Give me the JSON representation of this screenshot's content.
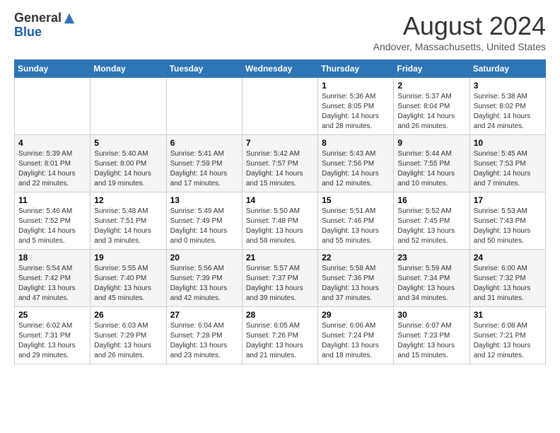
{
  "header": {
    "logo_line1": "General",
    "logo_line2": "Blue",
    "month_year": "August 2024",
    "location": "Andover, Massachusetts, United States"
  },
  "calendar": {
    "days_of_week": [
      "Sunday",
      "Monday",
      "Tuesday",
      "Wednesday",
      "Thursday",
      "Friday",
      "Saturday"
    ],
    "weeks": [
      [
        {
          "day": "",
          "info": ""
        },
        {
          "day": "",
          "info": ""
        },
        {
          "day": "",
          "info": ""
        },
        {
          "day": "",
          "info": ""
        },
        {
          "day": "1",
          "info": "Sunrise: 5:36 AM\nSunset: 8:05 PM\nDaylight: 14 hours\nand 28 minutes."
        },
        {
          "day": "2",
          "info": "Sunrise: 5:37 AM\nSunset: 8:04 PM\nDaylight: 14 hours\nand 26 minutes."
        },
        {
          "day": "3",
          "info": "Sunrise: 5:38 AM\nSunset: 8:02 PM\nDaylight: 14 hours\nand 24 minutes."
        }
      ],
      [
        {
          "day": "4",
          "info": "Sunrise: 5:39 AM\nSunset: 8:01 PM\nDaylight: 14 hours\nand 22 minutes."
        },
        {
          "day": "5",
          "info": "Sunrise: 5:40 AM\nSunset: 8:00 PM\nDaylight: 14 hours\nand 19 minutes."
        },
        {
          "day": "6",
          "info": "Sunrise: 5:41 AM\nSunset: 7:59 PM\nDaylight: 14 hours\nand 17 minutes."
        },
        {
          "day": "7",
          "info": "Sunrise: 5:42 AM\nSunset: 7:57 PM\nDaylight: 14 hours\nand 15 minutes."
        },
        {
          "day": "8",
          "info": "Sunrise: 5:43 AM\nSunset: 7:56 PM\nDaylight: 14 hours\nand 12 minutes."
        },
        {
          "day": "9",
          "info": "Sunrise: 5:44 AM\nSunset: 7:55 PM\nDaylight: 14 hours\nand 10 minutes."
        },
        {
          "day": "10",
          "info": "Sunrise: 5:45 AM\nSunset: 7:53 PM\nDaylight: 14 hours\nand 7 minutes."
        }
      ],
      [
        {
          "day": "11",
          "info": "Sunrise: 5:46 AM\nSunset: 7:52 PM\nDaylight: 14 hours\nand 5 minutes."
        },
        {
          "day": "12",
          "info": "Sunrise: 5:48 AM\nSunset: 7:51 PM\nDaylight: 14 hours\nand 3 minutes."
        },
        {
          "day": "13",
          "info": "Sunrise: 5:49 AM\nSunset: 7:49 PM\nDaylight: 14 hours\nand 0 minutes."
        },
        {
          "day": "14",
          "info": "Sunrise: 5:50 AM\nSunset: 7:48 PM\nDaylight: 13 hours\nand 58 minutes."
        },
        {
          "day": "15",
          "info": "Sunrise: 5:51 AM\nSunset: 7:46 PM\nDaylight: 13 hours\nand 55 minutes."
        },
        {
          "day": "16",
          "info": "Sunrise: 5:52 AM\nSunset: 7:45 PM\nDaylight: 13 hours\nand 52 minutes."
        },
        {
          "day": "17",
          "info": "Sunrise: 5:53 AM\nSunset: 7:43 PM\nDaylight: 13 hours\nand 50 minutes."
        }
      ],
      [
        {
          "day": "18",
          "info": "Sunrise: 5:54 AM\nSunset: 7:42 PM\nDaylight: 13 hours\nand 47 minutes."
        },
        {
          "day": "19",
          "info": "Sunrise: 5:55 AM\nSunset: 7:40 PM\nDaylight: 13 hours\nand 45 minutes."
        },
        {
          "day": "20",
          "info": "Sunrise: 5:56 AM\nSunset: 7:39 PM\nDaylight: 13 hours\nand 42 minutes."
        },
        {
          "day": "21",
          "info": "Sunrise: 5:57 AM\nSunset: 7:37 PM\nDaylight: 13 hours\nand 39 minutes."
        },
        {
          "day": "22",
          "info": "Sunrise: 5:58 AM\nSunset: 7:36 PM\nDaylight: 13 hours\nand 37 minutes."
        },
        {
          "day": "23",
          "info": "Sunrise: 5:59 AM\nSunset: 7:34 PM\nDaylight: 13 hours\nand 34 minutes."
        },
        {
          "day": "24",
          "info": "Sunrise: 6:00 AM\nSunset: 7:32 PM\nDaylight: 13 hours\nand 31 minutes."
        }
      ],
      [
        {
          "day": "25",
          "info": "Sunrise: 6:02 AM\nSunset: 7:31 PM\nDaylight: 13 hours\nand 29 minutes."
        },
        {
          "day": "26",
          "info": "Sunrise: 6:03 AM\nSunset: 7:29 PM\nDaylight: 13 hours\nand 26 minutes."
        },
        {
          "day": "27",
          "info": "Sunrise: 6:04 AM\nSunset: 7:28 PM\nDaylight: 13 hours\nand 23 minutes."
        },
        {
          "day": "28",
          "info": "Sunrise: 6:05 AM\nSunset: 7:26 PM\nDaylight: 13 hours\nand 21 minutes."
        },
        {
          "day": "29",
          "info": "Sunrise: 6:06 AM\nSunset: 7:24 PM\nDaylight: 13 hours\nand 18 minutes."
        },
        {
          "day": "30",
          "info": "Sunrise: 6:07 AM\nSunset: 7:23 PM\nDaylight: 13 hours\nand 15 minutes."
        },
        {
          "day": "31",
          "info": "Sunrise: 6:08 AM\nSunset: 7:21 PM\nDaylight: 13 hours\nand 12 minutes."
        }
      ]
    ]
  }
}
